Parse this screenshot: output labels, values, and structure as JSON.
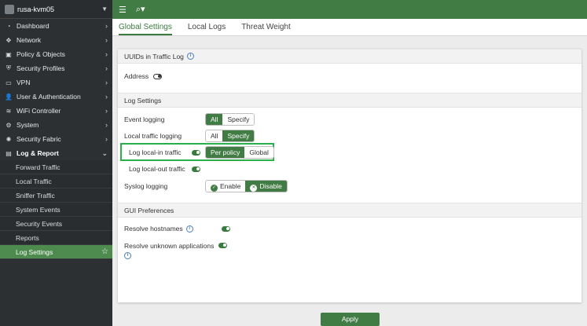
{
  "sidebar": {
    "device_name": "rusa-kvm05",
    "items": [
      {
        "icon": "dashboard-icon",
        "glyph": "◔",
        "label": "Dashboard"
      },
      {
        "icon": "network-icon",
        "glyph": "✥",
        "label": "Network"
      },
      {
        "icon": "policy-icon",
        "glyph": "▣",
        "label": "Policy & Objects"
      },
      {
        "icon": "shield-icon",
        "glyph": "⛨",
        "label": "Security Profiles"
      },
      {
        "icon": "vpn-icon",
        "glyph": "▭",
        "label": "VPN"
      },
      {
        "icon": "user-icon",
        "glyph": "👤",
        "label": "User & Authentication"
      },
      {
        "icon": "wifi-icon",
        "glyph": "≋",
        "label": "WiFi Controller"
      },
      {
        "icon": "gear-icon",
        "glyph": "⚙",
        "label": "System"
      },
      {
        "icon": "fabric-icon",
        "glyph": "✺",
        "label": "Security Fabric"
      },
      {
        "icon": "chart-icon",
        "glyph": "▤",
        "label": "Log & Report"
      }
    ],
    "subitems": [
      "Forward Traffic",
      "Local Traffic",
      "Sniffer Traffic",
      "System Events",
      "Security Events",
      "Reports",
      "Log Settings"
    ]
  },
  "topbar": {
    "menu_icon": "☰",
    "search_icon": "⌕▾"
  },
  "tabs": [
    "Global Settings",
    "Local Logs",
    "Threat Weight"
  ],
  "sections": {
    "uuids": "UUIDs in Traffic Log",
    "log_settings": "Log Settings",
    "gui": "GUI Preferences"
  },
  "fields": {
    "address": "Address",
    "event_logging": "Event logging",
    "local_traffic_logging": "Local traffic logging",
    "log_local_in": "Log local-in traffic",
    "log_local_out": "Log local-out traffic",
    "syslog_logging": "Syslog logging",
    "resolve_hostnames": "Resolve hostnames",
    "resolve_unknown_apps": "Resolve unknown applications"
  },
  "options": {
    "all": "All",
    "specify": "Specify",
    "per_policy": "Per policy",
    "global": "Global",
    "enable": "Enable",
    "disable": "Disable"
  },
  "apply_label": "Apply",
  "colors": {
    "accent": "#427c45",
    "highlight": "#29b04a",
    "sidebar": "#2d3033"
  }
}
